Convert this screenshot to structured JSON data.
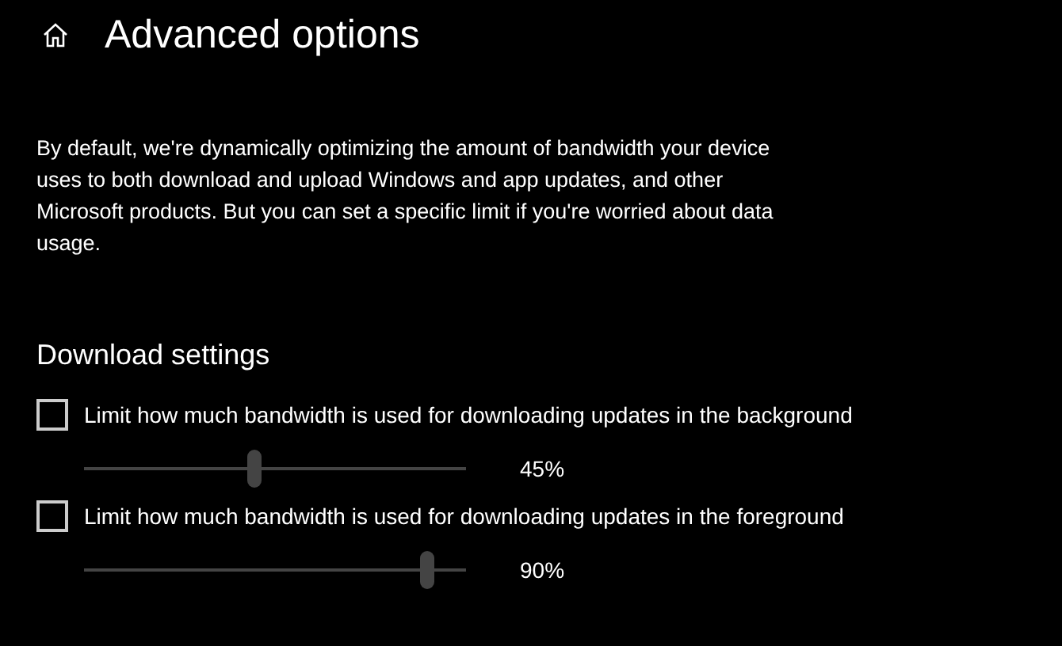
{
  "page": {
    "title": "Advanced options"
  },
  "description": "By default, we're dynamically optimizing the amount of bandwidth your device uses to both download and upload Windows and app updates, and other Microsoft products. But you can set a specific limit if you're worried about data usage.",
  "section": {
    "heading": "Download settings"
  },
  "limits": [
    {
      "label": "Limit how much bandwidth is used for downloading updates in the background",
      "checked": false,
      "level": 0.45,
      "reading": "45%"
    },
    {
      "label": "Limit how much bandwidth is used for downloading updates in the foreground",
      "checked": false,
      "level": 0.9,
      "reading": "90%"
    }
  ]
}
